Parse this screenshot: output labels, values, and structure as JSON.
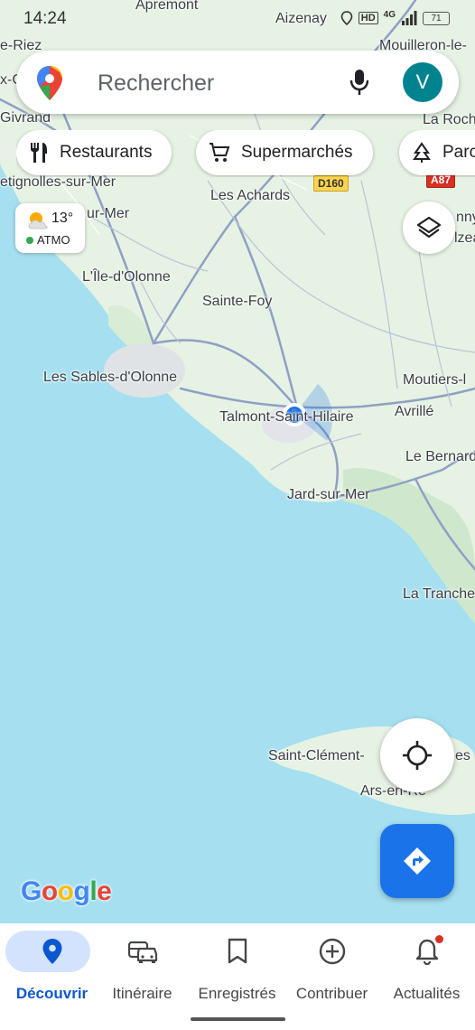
{
  "status_bar": {
    "time": "14:24",
    "hd_label": "HD",
    "network_label": "4G",
    "battery": "71"
  },
  "search": {
    "placeholder": "Rechercher",
    "avatar_letter": "V"
  },
  "chips": [
    {
      "label": "Restaurants",
      "icon": "fork-knife-icon"
    },
    {
      "label": "Supermarchés",
      "icon": "cart-icon"
    },
    {
      "label": "Parc",
      "icon": "tree-icon"
    }
  ],
  "weather": {
    "temperature": "13°",
    "air_quality": "ATMO"
  },
  "map": {
    "places": [
      "Apremont",
      "Aizenay",
      "e-Riez",
      "Mouilleron-le-",
      "Givrand",
      "La Roch",
      "etignolles-sur-Mer",
      "Les Achards",
      "ur-Mer",
      "nny",
      "lzea",
      "L'Île-d'Olonne",
      "Sainte-Foy",
      "Les Sables-d'Olonne",
      "Moutiers-l",
      "Talmont-Saint-Hilaire",
      "Avrillé",
      "Le Bernard",
      "Jard-sur-Mer",
      "La Tranche",
      "Saint-Clément-",
      "es",
      "Ars-en-Ré",
      "x-C"
    ],
    "roads": [
      "D160",
      "A87"
    ]
  },
  "brand": "Google",
  "bottom_nav": [
    {
      "label": "Découvrir",
      "icon": "pin-icon",
      "active": true
    },
    {
      "label": "Itinéraire",
      "icon": "car-icon",
      "active": false
    },
    {
      "label": "Enregistrés",
      "icon": "bookmark-icon",
      "active": false
    },
    {
      "label": "Contribuer",
      "icon": "plus-circle-icon",
      "active": false
    },
    {
      "label": "Actualités",
      "icon": "bell-icon",
      "active": false
    }
  ],
  "colors": {
    "accent": "#1a73e8",
    "active_pill": "#d3e3fd",
    "sea": "#a5dff0",
    "land": "#e8f3e4"
  }
}
